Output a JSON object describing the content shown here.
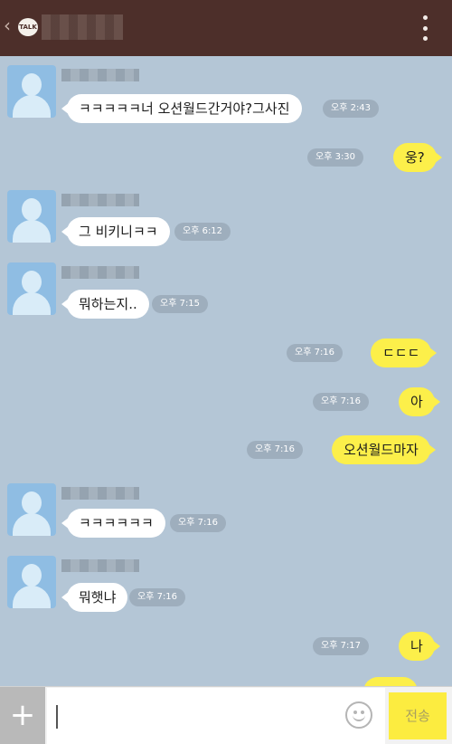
{
  "header": {
    "back_glyph": "‹",
    "logo_text": "TALK"
  },
  "messages": [
    {
      "id": "m1",
      "side": "in",
      "text": "ㅋㅋㅋㅋㅋ너 오션월드간거야?그사진",
      "time": "오후 2:43"
    },
    {
      "id": "m2",
      "side": "out",
      "text": "웅?",
      "time": "오후 3:30"
    },
    {
      "id": "m3",
      "side": "in",
      "text": "그 비키니ㅋㅋ",
      "time": "오후 6:12"
    },
    {
      "id": "m4",
      "side": "in",
      "text": "뭐하는지..",
      "time": "오후 7:15"
    },
    {
      "id": "m5",
      "side": "out",
      "text": "ㄷㄷㄷ",
      "time": "오후 7:16"
    },
    {
      "id": "m6",
      "side": "out",
      "text": "아",
      "time": "오후 7:16"
    },
    {
      "id": "m7",
      "side": "out",
      "text": "오션월드마자",
      "time": "오후 7:16"
    },
    {
      "id": "m8",
      "side": "in",
      "text": "ㅋㅋㅋㅋㅋㅋ",
      "time": "오후 7:16"
    },
    {
      "id": "m9",
      "side": "in",
      "text": "뭐햇냐",
      "time": "오후 7:16"
    },
    {
      "id": "m10",
      "side": "out",
      "text": "나",
      "time": "오후 7:17"
    }
  ],
  "input": {
    "plus_label": "+",
    "send_label": "전송"
  },
  "colors": {
    "header_bg": "#4d2f2a",
    "chat_bg": "#b4c6d6",
    "bubble_out": "#fcef4a",
    "bubble_in": "#ffffff",
    "time_badge": "#9eaebd"
  },
  "icons": {
    "back": "back-chevron-icon",
    "logo": "kakaotalk-logo-icon",
    "menu": "more-vertical-icon",
    "avatar": "default-profile-icon",
    "emoji": "emoji-smiley-icon"
  }
}
